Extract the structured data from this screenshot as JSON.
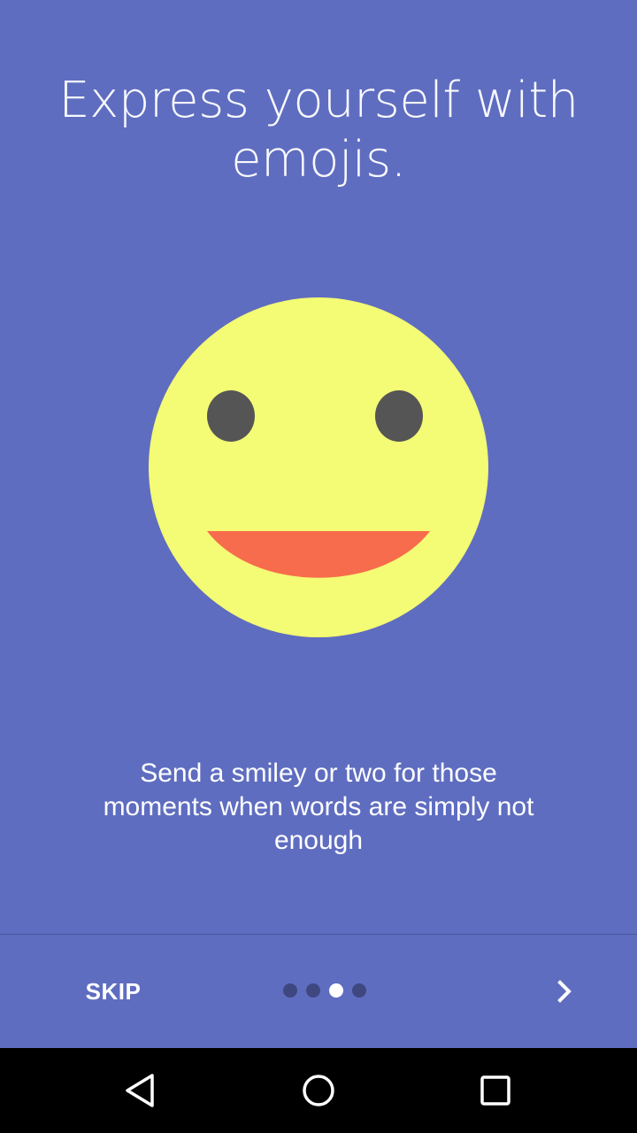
{
  "onboarding": {
    "headline": "Express yourself with emojis.",
    "description": "Send a smiley or two for those moments when words are simply not enough",
    "illustration_icon": "smiley-face-icon"
  },
  "footer": {
    "skip_label": "SKIP",
    "next_icon": "chevron-right-icon",
    "page_indicator": {
      "total": 4,
      "current": 3
    }
  },
  "system_nav": {
    "back_icon": "back-triangle-icon",
    "home_icon": "home-circle-icon",
    "recents_icon": "recents-square-icon"
  },
  "colors": {
    "background": "#5f6dc0",
    "face": "#f4fb74",
    "eyes": "#555555",
    "mouth": "#f76c4c",
    "dot_inactive": "#3f4780",
    "dot_active": "#ffffff"
  }
}
